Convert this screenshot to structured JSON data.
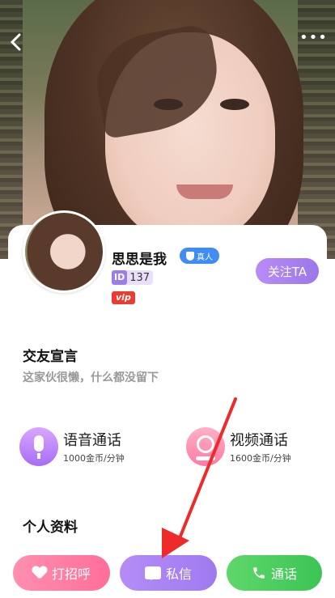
{
  "header": {
    "back_icon": "chevron-left-icon",
    "more_icon": "more-dots-icon",
    "more_glyph": "•••"
  },
  "profile": {
    "name": "思思是我",
    "real_badge": "真人",
    "id_label": "ID",
    "id_value": "137",
    "vip_label": "vip",
    "follow_label": "关注TA"
  },
  "motto_section": {
    "title": "交友宣言",
    "text": "这家伙很懒，什么都没留下"
  },
  "calls": {
    "voice": {
      "title": "语音通话",
      "price": "1000金币/分钟",
      "icon": "microphone-icon"
    },
    "video": {
      "title": "视频通话",
      "price": "1600金币/分钟",
      "icon": "camera-icon"
    }
  },
  "info_section": {
    "title": "个人资料"
  },
  "bottom_bar": {
    "greet_label": "打招呼",
    "message_label": "私信",
    "call_label": "通话"
  },
  "colors": {
    "accent_purple": "#9b77ea",
    "pink": "#ff6e99",
    "green": "#3bc455",
    "arrow_red": "#ee2a2a"
  }
}
